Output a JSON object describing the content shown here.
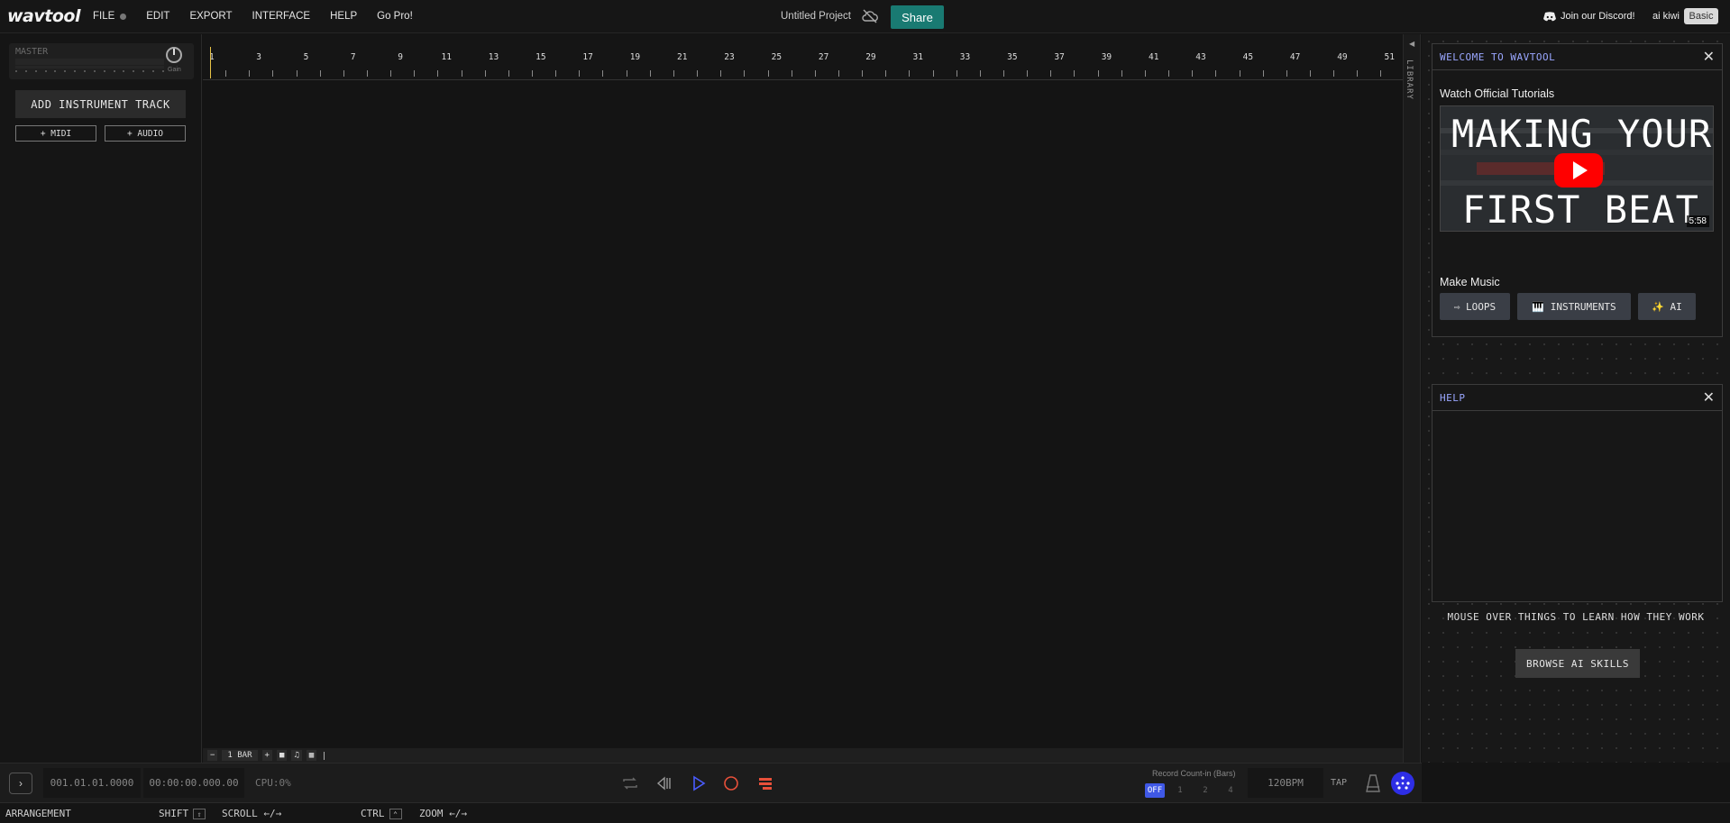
{
  "app": {
    "logo": "wavtool",
    "menu": [
      "FILE",
      "EDIT",
      "EXPORT",
      "INTERFACE",
      "HELP",
      "Go Pro!"
    ],
    "project_title": "Untitled Project",
    "share_label": "Share",
    "discord_label": "Join our Discord!",
    "username": "ai kiwi",
    "plan_badge": "Basic"
  },
  "left_panel": {
    "master_label": "MASTER",
    "gain_label": "Gain",
    "add_track_label": "ADD INSTRUMENT TRACK",
    "midi_label": "+ MIDI",
    "audio_label": "+ AUDIO"
  },
  "timeline": {
    "bar_numbers": [
      "1",
      "3",
      "5",
      "7",
      "9",
      "11",
      "13",
      "15",
      "17",
      "19",
      "21",
      "23",
      "25",
      "27",
      "29",
      "31",
      "33",
      "35",
      "37",
      "39",
      "41",
      "43",
      "45",
      "47",
      "49",
      "51"
    ],
    "footer": {
      "minus": "−",
      "bar_label": "1 BAR",
      "plus": "+"
    }
  },
  "library": {
    "label": "LIBRARY",
    "arrow": "◀"
  },
  "welcome": {
    "title": "WELCOME TO WAVTOOL",
    "close": "✕",
    "tutorials_label": "Watch Official Tutorials",
    "thumb_top": "MAKING YOUR",
    "thumb_bottom": "FIRST BEAT",
    "duration": "5:58",
    "make_music_label": "Make Music",
    "buttons": [
      "⇨ LOOPS",
      "🎹 INSTRUMENTS",
      "✨ AI"
    ]
  },
  "help": {
    "title": "HELP",
    "close": "✕",
    "hint": "MOUSE OVER THINGS TO LEARN HOW THEY WORK",
    "browse_label": "BROWSE AI SKILLS"
  },
  "transport": {
    "expand": "›",
    "position_bars": "001.01.01.0000",
    "position_time": "00:00:00.000.00",
    "cpu": "CPU:0%",
    "count_in_label": "Record Count-in (Bars)",
    "count_options": [
      "OFF",
      "1",
      "2",
      "4"
    ],
    "bpm": "120BPM",
    "tap": "TAP",
    "colors": {
      "play": "#4a5cff",
      "record": "#e8503a",
      "menu": "#e8503a"
    }
  },
  "statusbar": {
    "mode": "ARRANGEMENT",
    "shift": "SHIFT",
    "scroll": "SCROLL",
    "scroll_keys": "←/→",
    "ctrl": "CTRL",
    "zoom": "ZOOM",
    "zoom_keys": "←/→"
  }
}
